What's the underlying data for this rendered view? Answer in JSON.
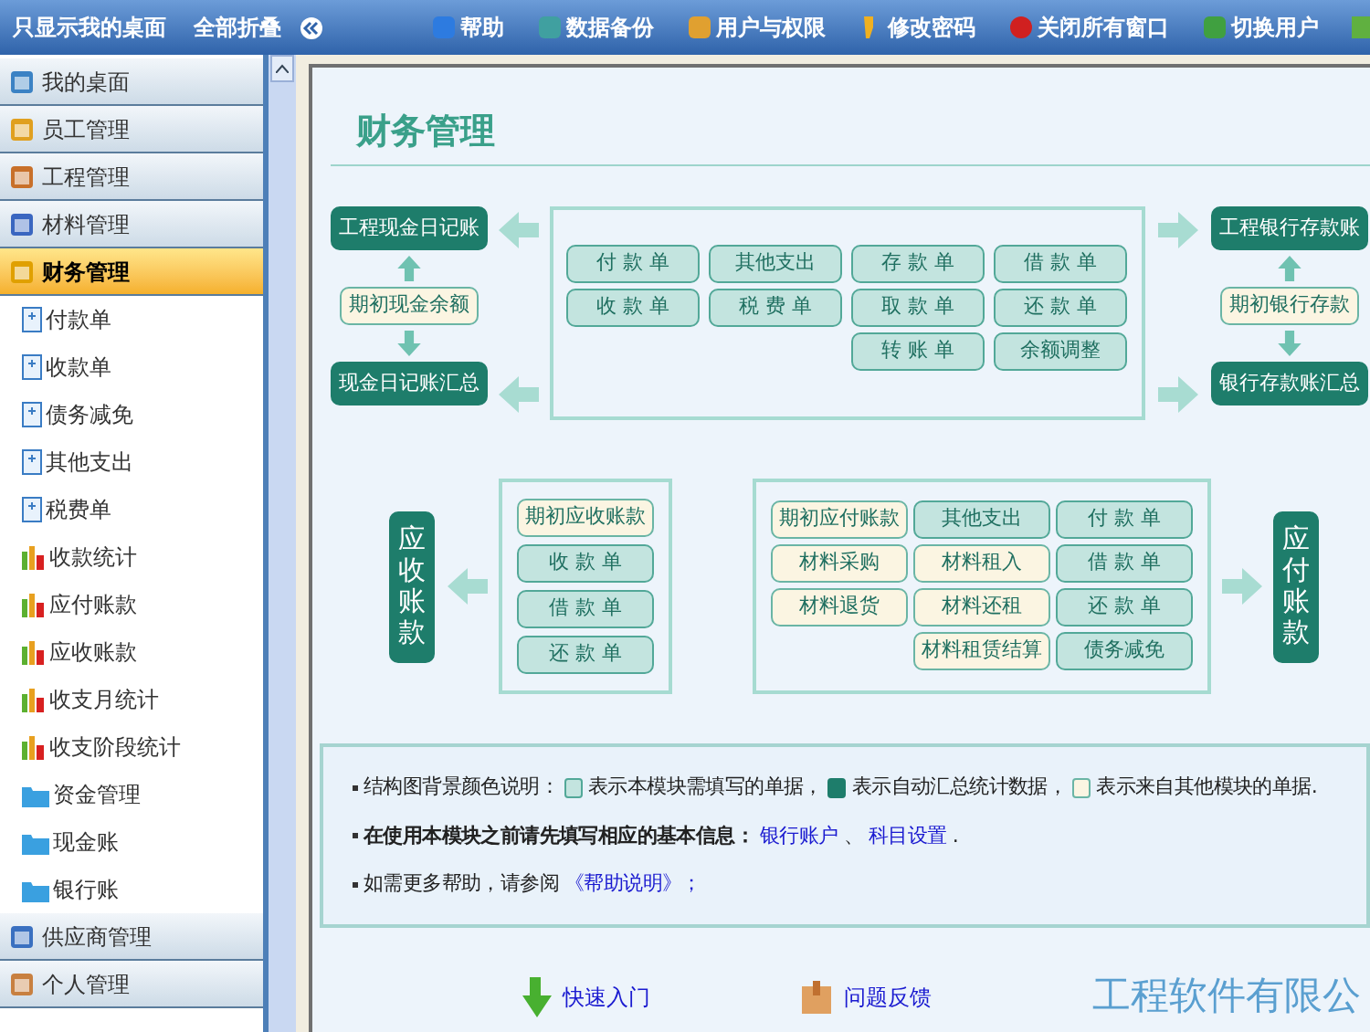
{
  "toolbar": {
    "left": [
      "只显示我的桌面",
      "全部折叠"
    ],
    "right": [
      {
        "label": "帮助"
      },
      {
        "label": "数据备份"
      },
      {
        "label": "用户与权限"
      },
      {
        "label": "修改密码"
      },
      {
        "label": "关闭所有窗口"
      },
      {
        "label": "切换用户"
      }
    ]
  },
  "sidebar": {
    "groups": [
      {
        "label": "我的桌面",
        "selected": false
      },
      {
        "label": "员工管理",
        "selected": false
      },
      {
        "label": "工程管理",
        "selected": false
      },
      {
        "label": "材料管理",
        "selected": false
      },
      {
        "label": "财务管理",
        "selected": true,
        "children": [
          {
            "label": "付款单",
            "kind": "form"
          },
          {
            "label": "收款单",
            "kind": "form"
          },
          {
            "label": "债务减免",
            "kind": "form"
          },
          {
            "label": "其他支出",
            "kind": "form"
          },
          {
            "label": "税费单",
            "kind": "form"
          },
          {
            "label": "收款统计",
            "kind": "report"
          },
          {
            "label": "应付账款",
            "kind": "report"
          },
          {
            "label": "应收账款",
            "kind": "report"
          },
          {
            "label": "收支月统计",
            "kind": "report"
          },
          {
            "label": "收支阶段统计",
            "kind": "report"
          },
          {
            "label": "资金管理",
            "kind": "folder"
          },
          {
            "label": "现金账",
            "kind": "folder"
          },
          {
            "label": "银行账",
            "kind": "folder"
          }
        ]
      },
      {
        "label": "供应商管理",
        "selected": false
      },
      {
        "label": "个人管理",
        "selected": false
      }
    ]
  },
  "page_title": "财务管理",
  "cash_flow": {
    "left": [
      {
        "label": "工程现金日记账",
        "kind": "summary"
      },
      {
        "label": "期初现金余额",
        "kind": "external"
      },
      {
        "label": "现金日记账汇总",
        "kind": "summary"
      }
    ],
    "form_columns": [
      [
        {
          "label": "付 款 单",
          "kind": "form"
        },
        {
          "label": "收 款 单",
          "kind": "form"
        }
      ],
      [
        {
          "label": "其他支出",
          "kind": "form"
        },
        {
          "label": "税 费 单",
          "kind": "form"
        }
      ],
      [
        {
          "label": "存 款 单",
          "kind": "form"
        },
        {
          "label": "取 款 单",
          "kind": "form"
        },
        {
          "label": "转 账 单",
          "kind": "form"
        }
      ],
      [
        {
          "label": "借 款 单",
          "kind": "form"
        },
        {
          "label": "还 款 单",
          "kind": "form"
        },
        {
          "label": "余额调整",
          "kind": "form"
        }
      ]
    ],
    "right": [
      {
        "label": "工程银行存款账",
        "kind": "summary"
      },
      {
        "label": "期初银行存款",
        "kind": "external"
      },
      {
        "label": "银行存款账汇总",
        "kind": "summary"
      }
    ]
  },
  "accounts": {
    "receivable": {
      "label": "应收账款",
      "kind": "summary",
      "items": [
        {
          "label": "期初应收账款",
          "kind": "external"
        },
        {
          "label": "收 款 单",
          "kind": "form"
        },
        {
          "label": "借 款 单",
          "kind": "form"
        },
        {
          "label": "还 款 单",
          "kind": "form"
        }
      ]
    },
    "payable": {
      "label": "应付账款",
      "kind": "summary",
      "columns": [
        [
          {
            "label": "期初应付账款",
            "kind": "external"
          },
          {
            "label": "材料采购",
            "kind": "external"
          },
          {
            "label": "材料退货",
            "kind": "external"
          }
        ],
        [
          {
            "label": "其他支出",
            "kind": "form"
          },
          {
            "label": "材料租入",
            "kind": "external"
          },
          {
            "label": "材料还租",
            "kind": "external"
          },
          {
            "label": "材料租赁结算",
            "kind": "external"
          }
        ],
        [
          {
            "label": "付 款 单",
            "kind": "form"
          },
          {
            "label": "借 款 单",
            "kind": "form"
          },
          {
            "label": "还 款 单",
            "kind": "form"
          },
          {
            "label": "债务减免",
            "kind": "form"
          }
        ]
      ]
    }
  },
  "notes": {
    "legend": {
      "prefix": "结构图背景颜色说明：",
      "entries": [
        {
          "kind": "form",
          "text": "表示本模块需填写的单据，"
        },
        {
          "kind": "summary",
          "text": "表示自动汇总统计数据，"
        },
        {
          "kind": "external",
          "text": "表示来自其他模块的单据."
        }
      ]
    },
    "setup": {
      "text": "在使用本模块之前请先填写相应的基本信息：",
      "links": [
        "银行账户",
        "科目设置"
      ],
      "separator": "、",
      "end": "."
    },
    "help": {
      "text": "如需更多帮助，请参阅",
      "link": "《帮助说明》；"
    }
  },
  "footer": {
    "links": [
      "快速入门",
      "问题反馈"
    ],
    "company": "工程软件有限公"
  }
}
